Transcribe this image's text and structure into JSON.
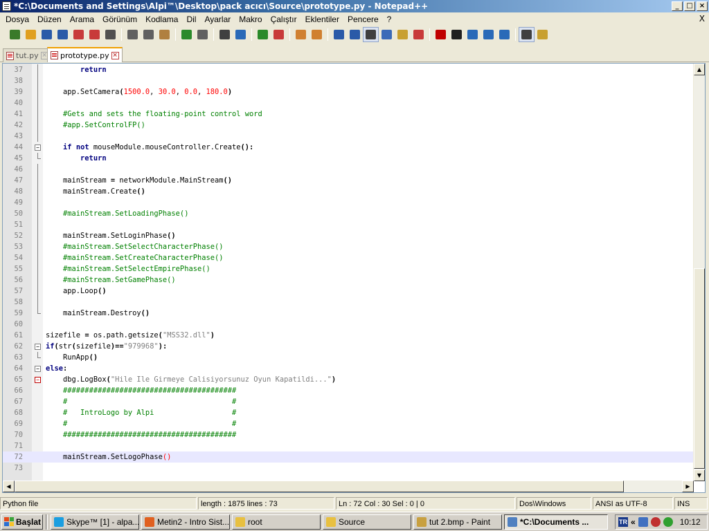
{
  "window": {
    "title": "*C:\\Documents and Settings\\Alpi™\\Desktop\\pack acıcı\\Source\\prototype.py - Notepad++",
    "controls": [
      "_",
      "□",
      "×"
    ]
  },
  "menu": {
    "items": [
      "Dosya",
      "Düzen",
      "Arama",
      "Görünüm",
      "Kodlama",
      "Dil",
      "Ayarlar",
      "Makro",
      "Çalıştır",
      "Eklentiler",
      "Pencere",
      "?"
    ],
    "close": "X"
  },
  "toolbar": {
    "icons": [
      "new-file-icon",
      "open-file-icon",
      "save-icon",
      "save-all-icon",
      "close-icon",
      "close-all-icon",
      "print-icon",
      "cut-icon",
      "copy-icon",
      "paste-icon",
      "undo-icon",
      "redo-icon",
      "find-icon",
      "replace-icon",
      "zoom-in-icon",
      "zoom-out-icon",
      "sync-vertical-icon",
      "sync-horizontal-icon",
      "word-wrap-icon",
      "show-all-chars-icon",
      "indent-guide-icon",
      "user-lang-icon",
      "doc-map-icon",
      "function-list-icon",
      "record-macro-icon",
      "stop-record-icon",
      "play-macro-icon",
      "run-macro-multiple-icon",
      "save-macro-icon",
      "spellcheck-icon",
      "plugin-icon"
    ],
    "colors": [
      "#3a7a2a",
      "#e0a020",
      "#2a5aa8",
      "#2a5aa8",
      "#c83a3a",
      "#c83a3a",
      "#505050",
      "#606060",
      "#606060",
      "#b08040",
      "#2a8a2a",
      "#606060",
      "#404040",
      "#2a6ab8",
      "#2a8a2a",
      "#c83a3a",
      "#d08030",
      "#d08030",
      "#2a5aa8",
      "#2a5aa8",
      "#404040",
      "#3a6ab8",
      "#c8a030",
      "#c83a3a",
      "#c00000",
      "#202020",
      "#2a6ab8",
      "#2a6ab8",
      "#2a6ab8",
      "#404040",
      "#c8a030"
    ]
  },
  "tabs": [
    {
      "label": "tut.py",
      "active": false
    },
    {
      "label": "prototype.py",
      "active": true
    }
  ],
  "editor": {
    "current_line": 72,
    "lines": [
      {
        "n": "37",
        "fold": "line",
        "segs": [
          [
            "        ",
            ""
          ],
          [
            "return",
            "kw"
          ]
        ]
      },
      {
        "n": "38",
        "fold": "line",
        "segs": []
      },
      {
        "n": "39",
        "fold": "line",
        "segs": [
          [
            "    app.SetCamera",
            ""
          ],
          [
            "(",
            "op"
          ],
          [
            "1500.0",
            "num"
          ],
          [
            ", ",
            ""
          ],
          [
            "30.0",
            "num"
          ],
          [
            ", ",
            ""
          ],
          [
            "0.0",
            "num"
          ],
          [
            ", ",
            ""
          ],
          [
            "180.0",
            "num"
          ],
          [
            ")",
            "op"
          ]
        ]
      },
      {
        "n": "40",
        "fold": "line",
        "segs": []
      },
      {
        "n": "41",
        "fold": "line",
        "segs": [
          [
            "    ",
            ""
          ],
          [
            "#Gets and sets the floating-point control word",
            "cmt"
          ]
        ]
      },
      {
        "n": "42",
        "fold": "line",
        "segs": [
          [
            "    ",
            ""
          ],
          [
            "#app.SetControlFP()",
            "cmt"
          ]
        ]
      },
      {
        "n": "43",
        "fold": "line",
        "segs": []
      },
      {
        "n": "44",
        "fold": "box",
        "segs": [
          [
            "    ",
            ""
          ],
          [
            "if",
            "kw"
          ],
          [
            " ",
            ""
          ],
          [
            "not",
            "kw"
          ],
          [
            " mouseModule.mouseController.Create",
            ""
          ],
          [
            "():",
            "op"
          ]
        ]
      },
      {
        "n": "45",
        "fold": "end",
        "segs": [
          [
            "        ",
            ""
          ],
          [
            "return",
            "kw"
          ]
        ]
      },
      {
        "n": "46",
        "fold": "line",
        "segs": []
      },
      {
        "n": "47",
        "fold": "line",
        "segs": [
          [
            "    mainStream ",
            ""
          ],
          [
            "=",
            "op"
          ],
          [
            " networkModule.MainStream",
            ""
          ],
          [
            "()",
            "op"
          ]
        ]
      },
      {
        "n": "48",
        "fold": "line",
        "segs": [
          [
            "    mainStream.Create",
            ""
          ],
          [
            "()",
            "op"
          ]
        ]
      },
      {
        "n": "49",
        "fold": "line",
        "segs": []
      },
      {
        "n": "50",
        "fold": "line",
        "segs": [
          [
            "    ",
            ""
          ],
          [
            "#mainStream.SetLoadingPhase()",
            "cmt"
          ]
        ]
      },
      {
        "n": "51",
        "fold": "line",
        "segs": []
      },
      {
        "n": "52",
        "fold": "line",
        "segs": [
          [
            "    mainStream.SetLoginPhase",
            ""
          ],
          [
            "()",
            "op"
          ]
        ]
      },
      {
        "n": "53",
        "fold": "line",
        "segs": [
          [
            "    ",
            ""
          ],
          [
            "#mainStream.SetSelectCharacterPhase()",
            "cmt"
          ]
        ]
      },
      {
        "n": "54",
        "fold": "line",
        "segs": [
          [
            "    ",
            ""
          ],
          [
            "#mainStream.SetCreateCharacterPhase()",
            "cmt"
          ]
        ]
      },
      {
        "n": "55",
        "fold": "line",
        "segs": [
          [
            "    ",
            ""
          ],
          [
            "#mainStream.SetSelectEmpirePhase()",
            "cmt"
          ]
        ]
      },
      {
        "n": "56",
        "fold": "line",
        "segs": [
          [
            "    ",
            ""
          ],
          [
            "#mainStream.SetGamePhase()",
            "cmt"
          ]
        ]
      },
      {
        "n": "57",
        "fold": "line",
        "segs": [
          [
            "    app.Loop",
            ""
          ],
          [
            "()",
            "op"
          ]
        ]
      },
      {
        "n": "58",
        "fold": "line",
        "segs": []
      },
      {
        "n": "59",
        "fold": "end",
        "segs": [
          [
            "    mainStream.Destroy",
            ""
          ],
          [
            "()",
            "op"
          ]
        ]
      },
      {
        "n": "60",
        "fold": "",
        "segs": []
      },
      {
        "n": "61",
        "fold": "",
        "segs": [
          [
            "sizefile ",
            ""
          ],
          [
            "=",
            "op"
          ],
          [
            " os.path.getsize",
            ""
          ],
          [
            "(",
            "op"
          ],
          [
            "\"MSS32.dll\"",
            "str"
          ],
          [
            ")",
            "op"
          ]
        ]
      },
      {
        "n": "62",
        "fold": "box",
        "segs": [
          [
            "if",
            "kw"
          ],
          [
            "(",
            "op"
          ],
          [
            "str",
            ""
          ],
          [
            "(",
            "op"
          ],
          [
            "sizefile",
            ""
          ],
          [
            ")==",
            "op"
          ],
          [
            "\"979968\"",
            "str"
          ],
          [
            "):",
            "op"
          ]
        ]
      },
      {
        "n": "63",
        "fold": "end",
        "segs": [
          [
            "    RunApp",
            ""
          ],
          [
            "()",
            "op"
          ]
        ]
      },
      {
        "n": "64",
        "fold": "box",
        "segs": [
          [
            "else",
            "kw"
          ],
          [
            ":",
            "op"
          ]
        ]
      },
      {
        "n": "65",
        "fold": "boxred",
        "segs": [
          [
            "    dbg.LogBox",
            ""
          ],
          [
            "(",
            "op"
          ],
          [
            "\"Hile Ile Girmeye Calisiyorsunuz Oyun Kapatildi...\"",
            "str"
          ],
          [
            ")",
            "op"
          ]
        ]
      },
      {
        "n": "66",
        "fold": "",
        "segs": [
          [
            "    ",
            ""
          ],
          [
            "########################################",
            "cmt"
          ]
        ]
      },
      {
        "n": "67",
        "fold": "",
        "segs": [
          [
            "    ",
            ""
          ],
          [
            "#                                      #",
            "cmt"
          ]
        ]
      },
      {
        "n": "68",
        "fold": "",
        "segs": [
          [
            "    ",
            ""
          ],
          [
            "#   IntroLogo by Alpi                  #",
            "cmt"
          ]
        ]
      },
      {
        "n": "69",
        "fold": "",
        "segs": [
          [
            "    ",
            ""
          ],
          [
            "#                                      #",
            "cmt"
          ]
        ]
      },
      {
        "n": "70",
        "fold": "",
        "segs": [
          [
            "    ",
            ""
          ],
          [
            "########################################",
            "cmt"
          ]
        ]
      },
      {
        "n": "71",
        "fold": "",
        "segs": []
      },
      {
        "n": "72",
        "fold": "",
        "segs": [
          [
            "    mainStream.SetLogoPhase",
            ""
          ],
          [
            "()",
            "num"
          ]
        ]
      },
      {
        "n": "73",
        "fold": "",
        "segs": []
      }
    ]
  },
  "status": {
    "lang": "Python file",
    "length": "length : 1875    lines : 73",
    "position": "Ln : 72    Col : 30    Sel : 0 | 0",
    "eol": "Dos\\Windows",
    "encoding": "ANSI as UTF-8",
    "mode": "INS"
  },
  "taskbar": {
    "start": "Başlat",
    "tasks": [
      {
        "label": "Skype™ [1] - alpa...",
        "icon": "skype-icon",
        "color": "#1a9ee0",
        "active": false
      },
      {
        "label": "Metin2 - Intro Sist...",
        "icon": "firefox-icon",
        "color": "#e06020",
        "active": false
      },
      {
        "label": "root",
        "icon": "folder-icon",
        "color": "#e8c040",
        "active": false
      },
      {
        "label": "Source",
        "icon": "folder-icon",
        "color": "#e8c040",
        "active": false
      },
      {
        "label": "tut 2.bmp - Paint",
        "icon": "paint-icon",
        "color": "#c8a040",
        "active": false
      },
      {
        "label": "*C:\\Documents ...",
        "icon": "notepad-icon",
        "color": "#5080c0",
        "active": true
      }
    ],
    "tray_lang": "TR",
    "clock": "10:12"
  }
}
